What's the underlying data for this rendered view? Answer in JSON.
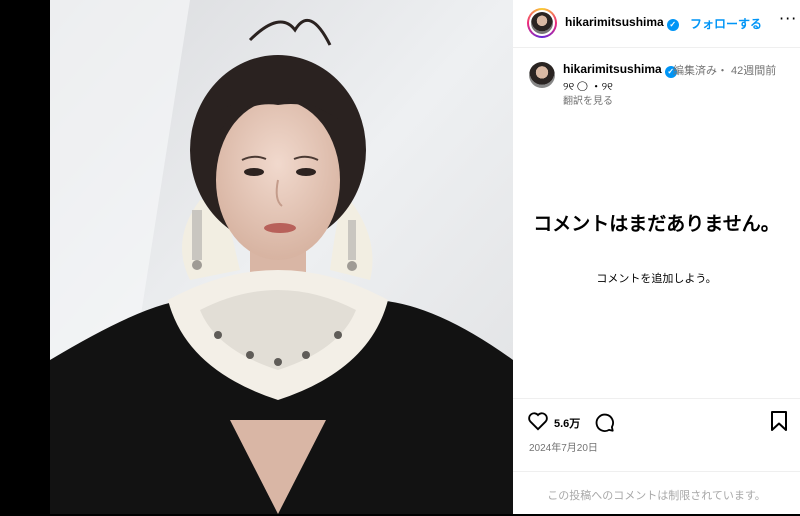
{
  "post_header": {
    "username": "hikarimitsushima",
    "verified_icon": "verified-badge-icon",
    "follow_label": "フォローする",
    "more_icon": "more-options-icon",
    "more_glyph": "···"
  },
  "caption": {
    "username": "hikarimitsushima",
    "meta": "編集済み・ 42週間前",
    "text": "୨୧ ◯ ・୨୧",
    "translate_label": "翻訳を見る"
  },
  "comments": {
    "empty_title": "コメントはまだありません。",
    "empty_subtitle": "コメントを追加しよう。"
  },
  "actions": {
    "like_icon": "heart-icon",
    "like_count": "5.6万",
    "comment_icon": "comment-icon",
    "save_icon": "bookmark-icon",
    "date": "2024年7月20日"
  },
  "footer": {
    "restricted_text": "この投稿へのコメントは制限されています。"
  },
  "colors": {
    "accent": "#0095f6",
    "muted_text": "#737373",
    "background": "#ffffff"
  }
}
